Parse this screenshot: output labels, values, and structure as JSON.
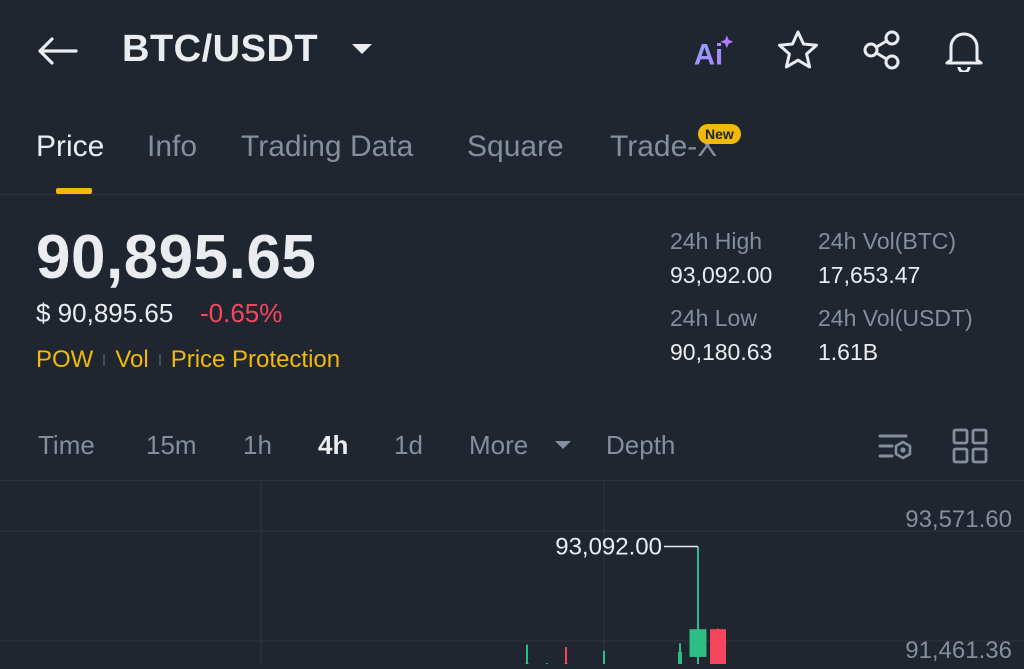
{
  "header": {
    "title": "BTC/USDT",
    "icons": [
      "back-arrow-icon",
      "caret-down-icon",
      "ai-icon",
      "star-icon",
      "share-icon",
      "bell-icon"
    ],
    "ai_label": "Ai"
  },
  "tabs": [
    {
      "label": "Price",
      "active": true
    },
    {
      "label": "Info"
    },
    {
      "label": "Trading Data"
    },
    {
      "label": "Square"
    },
    {
      "label": "Trade-X",
      "badge": "New"
    }
  ],
  "price": {
    "last": "90,895.65",
    "usd": "$ 90,895.65",
    "change": "-0.65%",
    "tags": [
      "POW",
      "Vol",
      "Price Protection"
    ]
  },
  "stats": {
    "high_label": "24h High",
    "high": "93,092.00",
    "vol_btc_label": "24h Vol(BTC)",
    "vol_btc": "17,653.47",
    "low_label": "24h Low",
    "low": "90,180.63",
    "vol_usdt_label": "24h Vol(USDT)",
    "vol_usdt": "1.61B"
  },
  "intervals": [
    {
      "label": "Time"
    },
    {
      "label": "15m"
    },
    {
      "label": "1h"
    },
    {
      "label": "4h",
      "active": true
    },
    {
      "label": "1d"
    },
    {
      "label": "More"
    },
    {
      "label": "Depth"
    }
  ],
  "colors": {
    "up": "#2ebd85",
    "down": "#f6465d",
    "accent": "#f0b90b",
    "bg": "#202630",
    "muted": "#848e9c"
  },
  "chart_data": {
    "type": "candlestick",
    "y_axis_labels": [
      "93,571.60",
      "91,461.36"
    ],
    "ylim": [
      91000,
      93800
    ],
    "high_marker": "93,092.00",
    "candles": [
      {
        "o": 91150,
        "h": 91500,
        "l": 91050,
        "c": 91200,
        "dir": "up"
      },
      {
        "o": 91100,
        "h": 91200,
        "l": 91000,
        "c": 91050,
        "dir": "up"
      },
      {
        "o": 91200,
        "h": 91460,
        "l": 91050,
        "c": 91150,
        "dir": "down"
      },
      {
        "o": 91050,
        "h": 91150,
        "l": 90980,
        "c": 91080,
        "dir": "up"
      },
      {
        "o": 91060,
        "h": 91400,
        "l": 91000,
        "c": 91130,
        "dir": "up"
      },
      {
        "o": 91100,
        "h": 91140,
        "l": 91000,
        "c": 91050,
        "dir": "down"
      },
      {
        "o": 91080,
        "h": 91150,
        "l": 91020,
        "c": 91120,
        "dir": "up"
      },
      {
        "o": 91100,
        "h": 91520,
        "l": 91000,
        "c": 91380,
        "dir": "up"
      },
      {
        "o": 91300,
        "h": 93092,
        "l": 91100,
        "c": 91750,
        "dir": "up"
      },
      {
        "o": 91750,
        "h": 91760,
        "l": 91000,
        "c": 91100,
        "dir": "down"
      }
    ]
  }
}
